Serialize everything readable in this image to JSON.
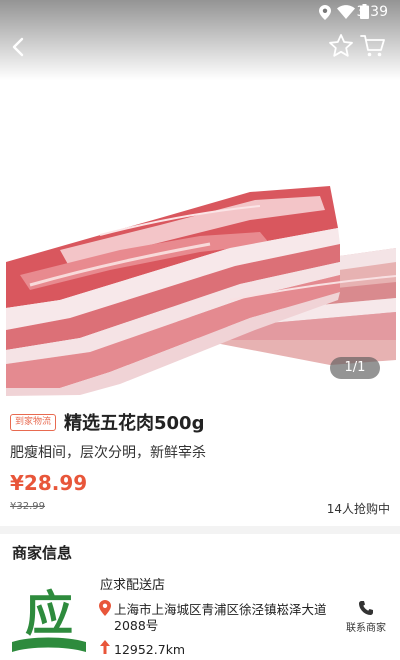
{
  "status_bar": {
    "time": "3:39",
    "icons": [
      "location-icon",
      "wifi-icon",
      "battery-icon"
    ]
  },
  "nav": {
    "icons": [
      "back-arrow-icon",
      "star-icon",
      "cart-icon"
    ]
  },
  "gallery": {
    "counter": "1/1"
  },
  "product": {
    "tag": "到家物流",
    "title": "精选五花肉500g",
    "subtitle": "肥瘦相间，层次分明，新鲜宰杀",
    "price": "¥28.99",
    "original_price": "¥32.99",
    "buyers": "14人抢购中"
  },
  "seller": {
    "heading": "商家信息",
    "logo_char": "应",
    "name": "应求配送店",
    "address": "上海市上海城区青浦区徐泾镇崧泽大道2088号",
    "distance": "12952.7km",
    "contact_label": "联系商家"
  },
  "colors": {
    "accent": "#e8563a",
    "logo_green": "#2e8b3d",
    "tag": "#e86a50"
  }
}
